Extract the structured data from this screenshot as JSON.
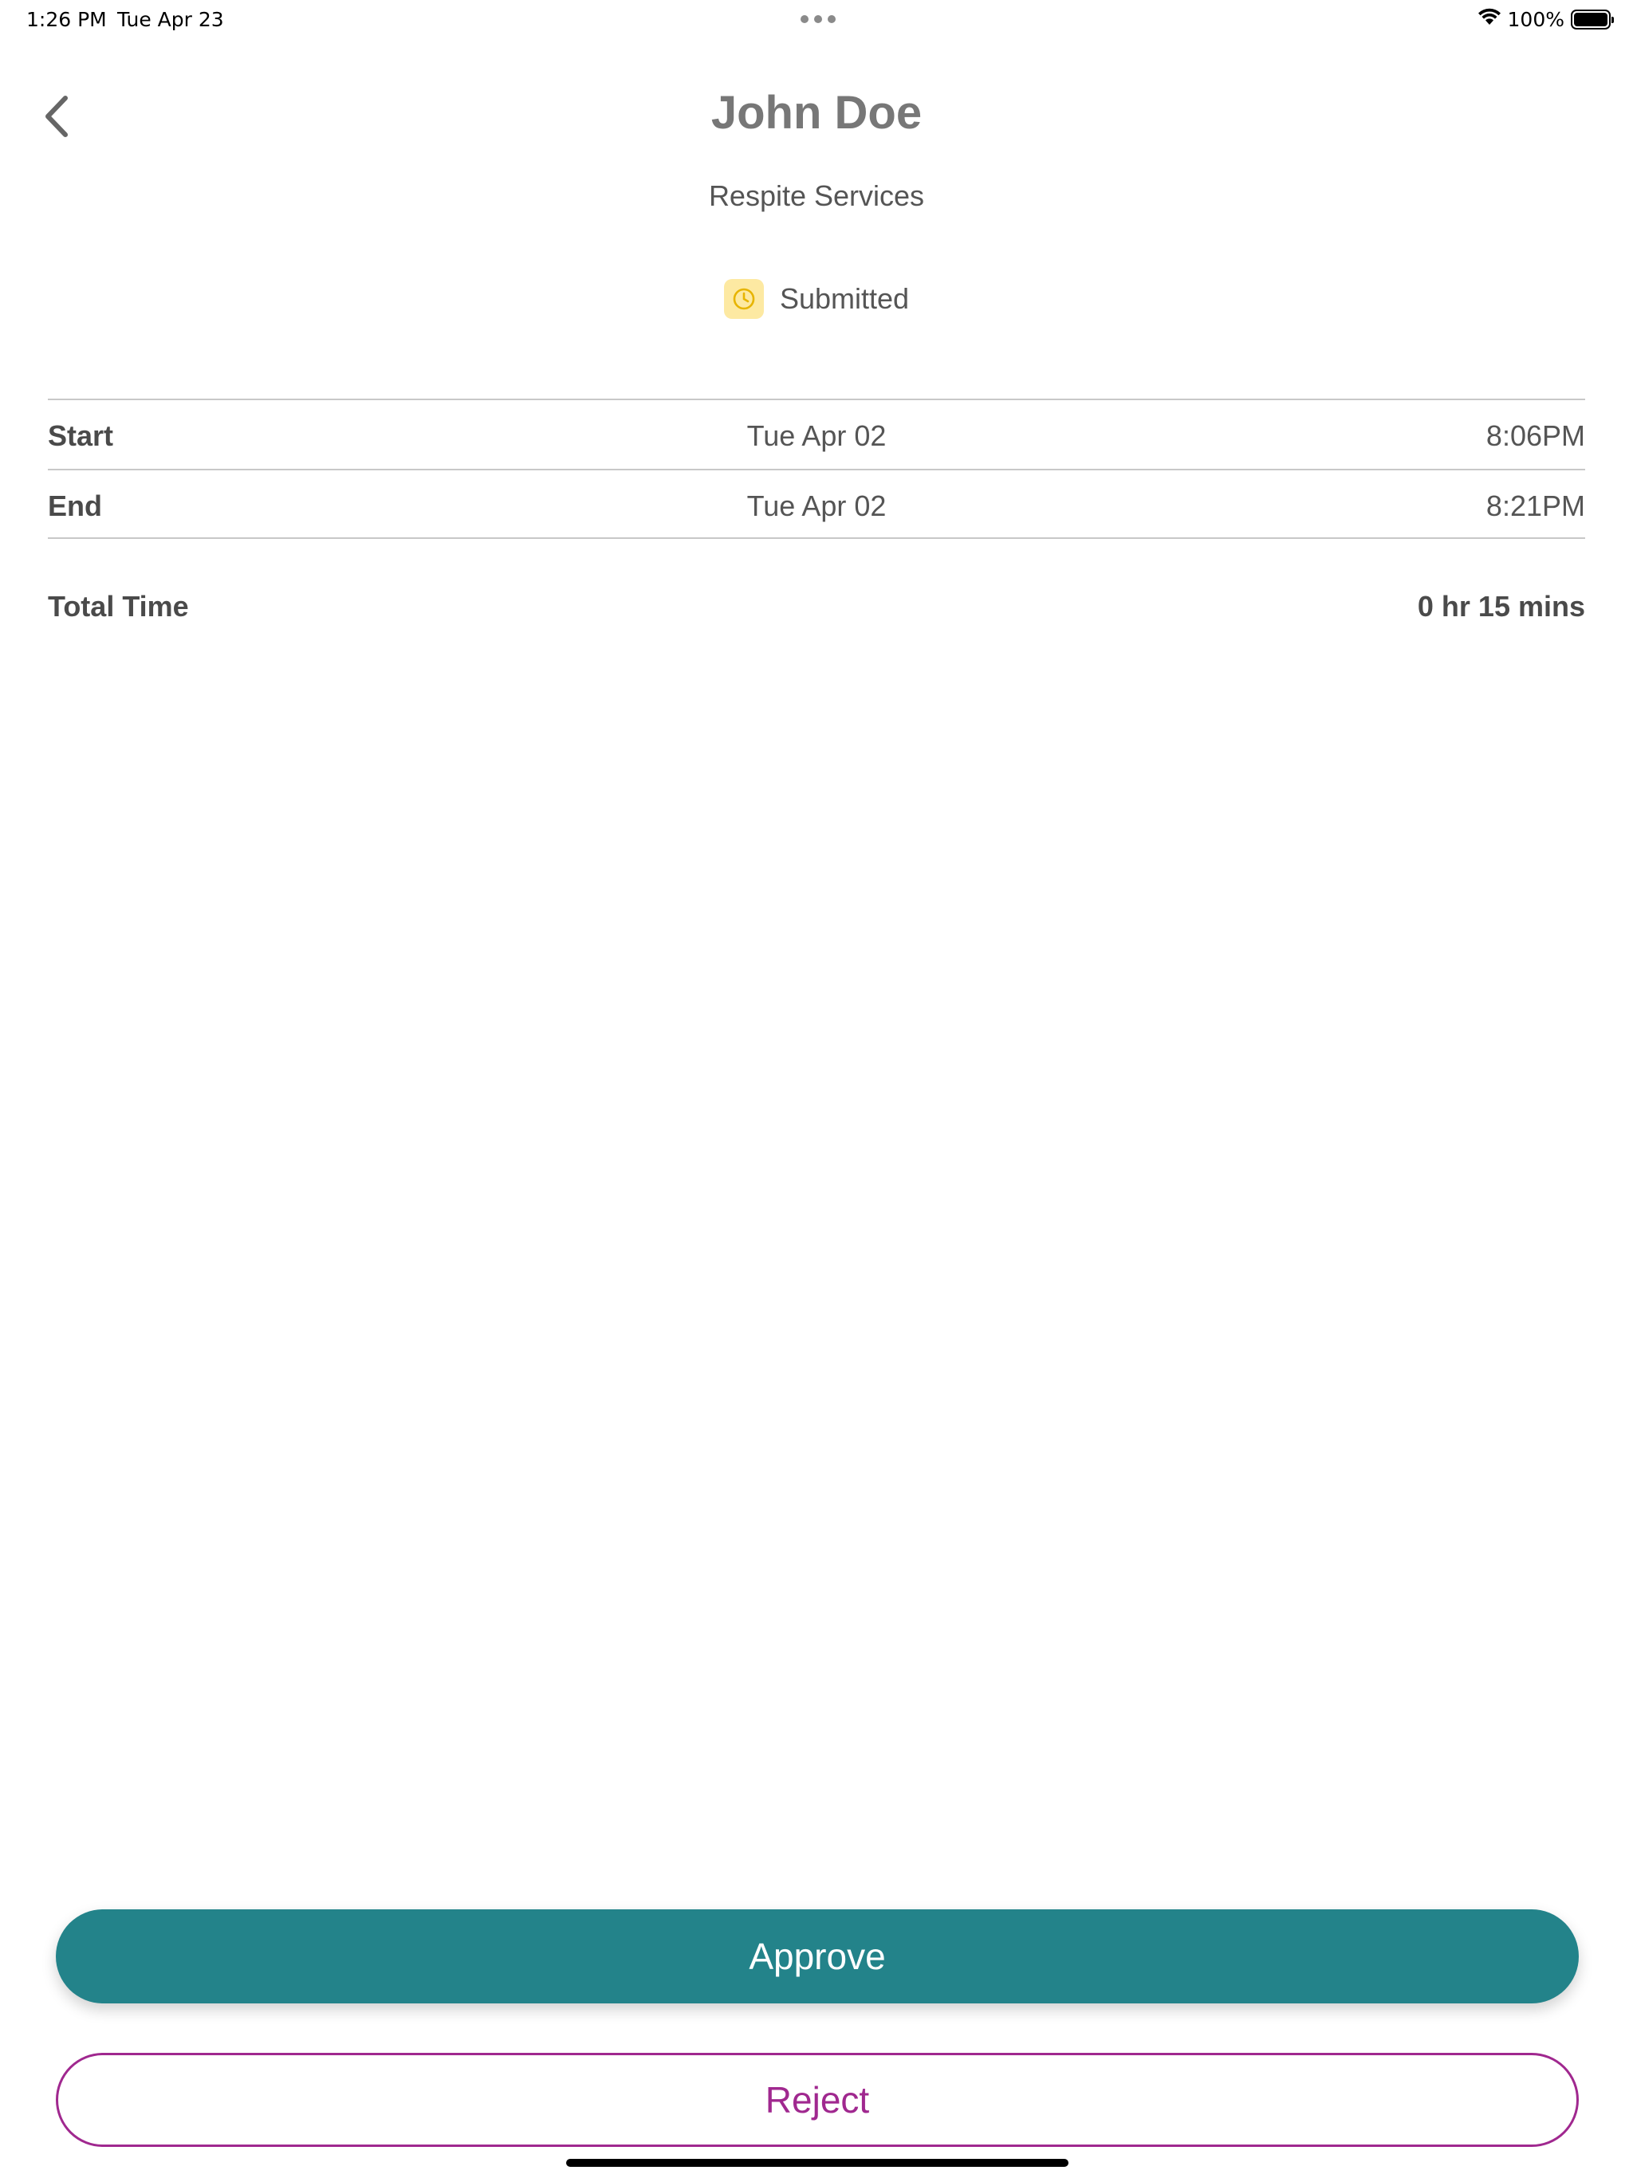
{
  "status_bar": {
    "time": "1:26 PM",
    "date": "Tue Apr 23",
    "battery": "100%",
    "icons": [
      "wifi-icon",
      "battery-icon"
    ]
  },
  "header": {
    "back_icon": "chevron-left-icon",
    "title": "John Doe",
    "subtitle": "Respite Services",
    "status_label": "Submitted",
    "status_icon": "clock-icon",
    "status_color": "#fde9a2"
  },
  "rows": [
    {
      "label": "Start",
      "date": "Tue Apr 02",
      "time": "8:06PM"
    },
    {
      "label": "End",
      "date": "Tue Apr 02",
      "time": "8:21PM"
    }
  ],
  "total": {
    "label": "Total Time",
    "value": "0 hr 15 mins"
  },
  "actions": {
    "approve_label": "Approve",
    "approve_color": "#23838a",
    "reject_label": "Reject",
    "reject_color": "#a0288f"
  }
}
